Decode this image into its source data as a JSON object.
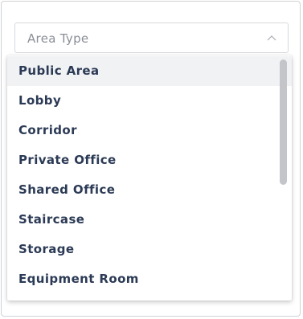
{
  "select": {
    "placeholder": "Area Type",
    "state": "open",
    "chevron_icon": "chevron-up-icon"
  },
  "dropdown": {
    "highlighted_index": 0,
    "options": [
      "Public Area",
      "Lobby",
      "Corridor",
      "Private Office",
      "Shared Office",
      "Staircase",
      "Storage",
      "Equipment Room"
    ]
  },
  "scrollbar": {
    "visible_fraction": 0.53,
    "scroll_position": 0
  },
  "colors": {
    "option_text": "#2b3a55",
    "placeholder_text": "#8a8f96",
    "highlight_background": "#f1f2f4",
    "border": "#d6d9dd",
    "scrollbar_thumb": "#c3c5c8"
  }
}
